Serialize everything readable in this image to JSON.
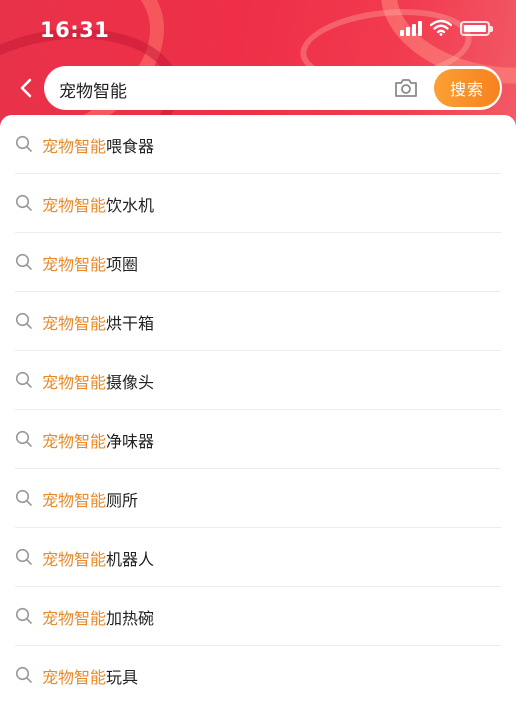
{
  "status_bar": {
    "time": "16:31"
  },
  "search": {
    "query": "宠物智能",
    "button_label": "搜索"
  },
  "suggestions": [
    {
      "highlight": "宠物智能",
      "rest": "喂食器"
    },
    {
      "highlight": "宠物智能",
      "rest": "饮水机"
    },
    {
      "highlight": "宠物智能",
      "rest": "项圈"
    },
    {
      "highlight": "宠物智能",
      "rest": "烘干箱"
    },
    {
      "highlight": "宠物智能",
      "rest": "摄像头"
    },
    {
      "highlight": "宠物智能",
      "rest": "净味器"
    },
    {
      "highlight": "宠物智能",
      "rest": "厕所"
    },
    {
      "highlight": "宠物智能",
      "rest": "机器人"
    },
    {
      "highlight": "宠物智能",
      "rest": "加热碗"
    },
    {
      "highlight": "宠物智能",
      "rest": "玩具"
    }
  ],
  "icons": {
    "back": "chevron-left-icon",
    "camera": "camera-icon",
    "suggestion": "search-icon",
    "signal": "cellular-signal-icon",
    "wifi": "wifi-icon",
    "battery": "battery-icon"
  },
  "colors": {
    "header_red": "#ee2f47",
    "highlight_orange": "#e88a2a",
    "search_button_orange": "#f7811e"
  }
}
